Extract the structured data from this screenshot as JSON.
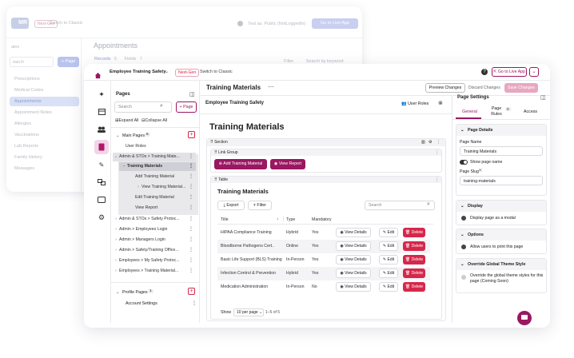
{
  "colors": {
    "brand": "#9a1761",
    "danger": "#d6274b",
    "accent_pink": "#e24a8d"
  },
  "bg": {
    "logo": "MR",
    "nextgen": "Next-Gen",
    "switch": "Switch to Classic",
    "test_as": "Test as: Public (NotLoggedIn)",
    "go_live": "Go to Live App",
    "pages_label": "ales",
    "search": "earch",
    "add_page": "+ Page",
    "title": "Appointments",
    "tab_records": "Records",
    "tab_records_count": "5",
    "tab_fields": "Fields",
    "tab_fields_count": "7",
    "filter": "Filter",
    "search_keyword": "Search by keyword",
    "nav": [
      "Prescriptions",
      "Medical Codes",
      "Appointments",
      "Appointment Notes",
      "Allergies",
      "Vaccinations",
      "Lab Reports",
      "Family History",
      "Messages"
    ]
  },
  "fg": {
    "app_name": "Employee Training Safety",
    "nextgen": "Next-Gen",
    "switch": "Switch to Classic",
    "go_live": "Go to Live App",
    "page_title": "Training Materials",
    "preview": "Preview Changes",
    "discard": "Discard Changes",
    "save": "Save Changes",
    "pages_heading": "Pages",
    "search_placeholder": "Search",
    "add_page": "+ Page",
    "expand_all": "Expand All",
    "collapse_all": "Collapse All",
    "main_pages": "Main Pages",
    "main_pages_count": "6",
    "profile_pages": "Profile Pages",
    "profile_pages_count": "1",
    "account_settings": "Account Settings",
    "pages": [
      "User Roles",
      "Admin & STOs > Training Mate...",
      "Training Materials",
      "Add Training Material",
      "View Training Material...",
      "Edit Training Material",
      "View Report",
      "Admin & STOs > Safety Protoc...",
      "Admin > Employees Login",
      "Admin > Managers Login",
      "Admin > Safety/Training Office...",
      "Employees > My Safety Protoc...",
      "Employees > Training Material..."
    ],
    "canvas_title": "Employee Training Safety",
    "user_roles": "User Roles",
    "heading": "Training Materials",
    "section_label": "Section",
    "link_group_label": "Link Group",
    "add_btn": "Add Training Material",
    "view_report_btn": "View Report",
    "table_label": "Table",
    "table_title": "Training Materials",
    "export": "Export",
    "filter": "Filter",
    "search_placeholder2": "Search",
    "columns": [
      "Title",
      "Type",
      "Mandatory"
    ],
    "rows": [
      {
        "title": "HIPAA Compliance Training",
        "type": "Hybrid",
        "mandatory": "Yes"
      },
      {
        "title": "Bloodborne Pathogens Cert..",
        "type": "Online",
        "mandatory": "Yes"
      },
      {
        "title": "Basic Life Support (BLS) Training",
        "type": "In-Person",
        "mandatory": "Yes"
      },
      {
        "title": "Infection Control & Prevention",
        "type": "Hybrid",
        "mandatory": "Yes"
      },
      {
        "title": "Medication Administration",
        "type": "In-Person",
        "mandatory": "No"
      }
    ],
    "view_details": "View Details",
    "edit": "Edit",
    "delete": "Delete",
    "show": "Show",
    "per_page": "10 per page",
    "range": "1–5 of 5"
  },
  "settings": {
    "title": "Page Settings",
    "tabs": [
      "General",
      "Page Rules",
      "Access"
    ],
    "page_rules_count": "0",
    "details_h": "Page Details",
    "page_name_label": "Page Name",
    "page_name": "Training Materials",
    "show_page_name": "Show page name",
    "page_slug_label": "Page Slug",
    "page_slug": "training-materials",
    "display_h": "Display",
    "display_modal": "Display page as a modal",
    "options_h": "Options",
    "allow_print": "Allow users to print this page",
    "override_h": "Override Global Theme Style",
    "override_text": "Override the global theme styles for this page (Coming Soon)"
  }
}
